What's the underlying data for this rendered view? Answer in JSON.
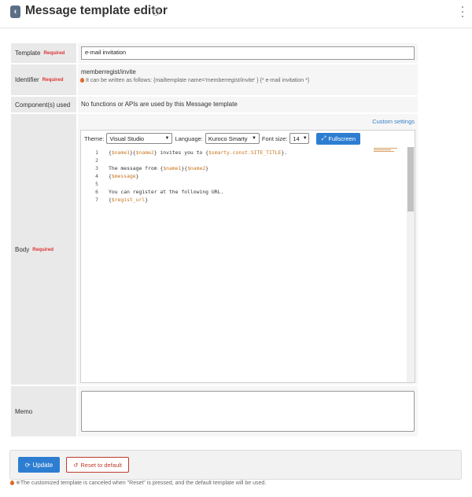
{
  "header": {
    "back_icon": "chevron-left-icon",
    "back_glyph": "‹",
    "title": "Message template editor",
    "help_glyph": "?"
  },
  "form": {
    "template": {
      "label": "Template",
      "required": "Required",
      "value": "e-mail invitation"
    },
    "identifier": {
      "label": "Identifier",
      "required": "Required",
      "value": "memberregist/invite",
      "hint": "It can be written as follows: {mailtemplate name='memberregist/invite' } {* e-mail invitation *}"
    },
    "components": {
      "label": "Component(s) used",
      "value": "No functions or APIs are used by this Message template"
    },
    "body": {
      "label": "Body",
      "required": "Required",
      "custom_settings": "Custom settings",
      "toolbar": {
        "theme_label": "Theme:",
        "theme_value": "Visual Studio",
        "language_label": "Language:",
        "language_value": "Kuroco Smarty",
        "font_size_label": "Font size:",
        "font_size_value": "14",
        "fullscreen_label": "Fullscreen",
        "fullscreen_glyph": "⤢"
      },
      "lines": [
        {
          "num": "1",
          "segments": [
            {
              "t": "{",
              "c": "plain"
            },
            {
              "t": "$name1",
              "c": "var"
            },
            {
              "t": "}{",
              "c": "plain"
            },
            {
              "t": "$name2",
              "c": "var"
            },
            {
              "t": "} invites you to {",
              "c": "plain"
            },
            {
              "t": "$smarty.const.SITE_TITLE",
              "c": "var"
            },
            {
              "t": "}.",
              "c": "plain"
            }
          ]
        },
        {
          "num": "2",
          "segments": []
        },
        {
          "num": "3",
          "segments": [
            {
              "t": "The message from {",
              "c": "plain"
            },
            {
              "t": "$name1",
              "c": "var"
            },
            {
              "t": "}{",
              "c": "plain"
            },
            {
              "t": "$name2",
              "c": "var"
            },
            {
              "t": "}",
              "c": "plain"
            }
          ]
        },
        {
          "num": "4",
          "segments": [
            {
              "t": "{",
              "c": "plain"
            },
            {
              "t": "$message",
              "c": "var"
            },
            {
              "t": "}",
              "c": "plain"
            }
          ]
        },
        {
          "num": "5",
          "segments": []
        },
        {
          "num": "6",
          "segments": [
            {
              "t": "You can register at the following URL.",
              "c": "plain"
            }
          ]
        },
        {
          "num": "7",
          "segments": [
            {
              "t": "{",
              "c": "plain"
            },
            {
              "t": "$regist_url",
              "c": "var"
            },
            {
              "t": "}",
              "c": "plain"
            }
          ]
        }
      ]
    },
    "memo": {
      "label": "Memo",
      "value": ""
    }
  },
  "footer": {
    "update_label": "Update",
    "update_glyph": "⟳",
    "reset_label": "Reset to default",
    "reset_glyph": "↺",
    "note": "※The customized template is canceled when \"Reset\" is pressed, and the default template will be used."
  },
  "colors": {
    "primary": "#2d7ed1",
    "required": "#dd3333",
    "danger": "#c0392b",
    "hint": "#e0682b",
    "code_variable": "#c8761e"
  }
}
